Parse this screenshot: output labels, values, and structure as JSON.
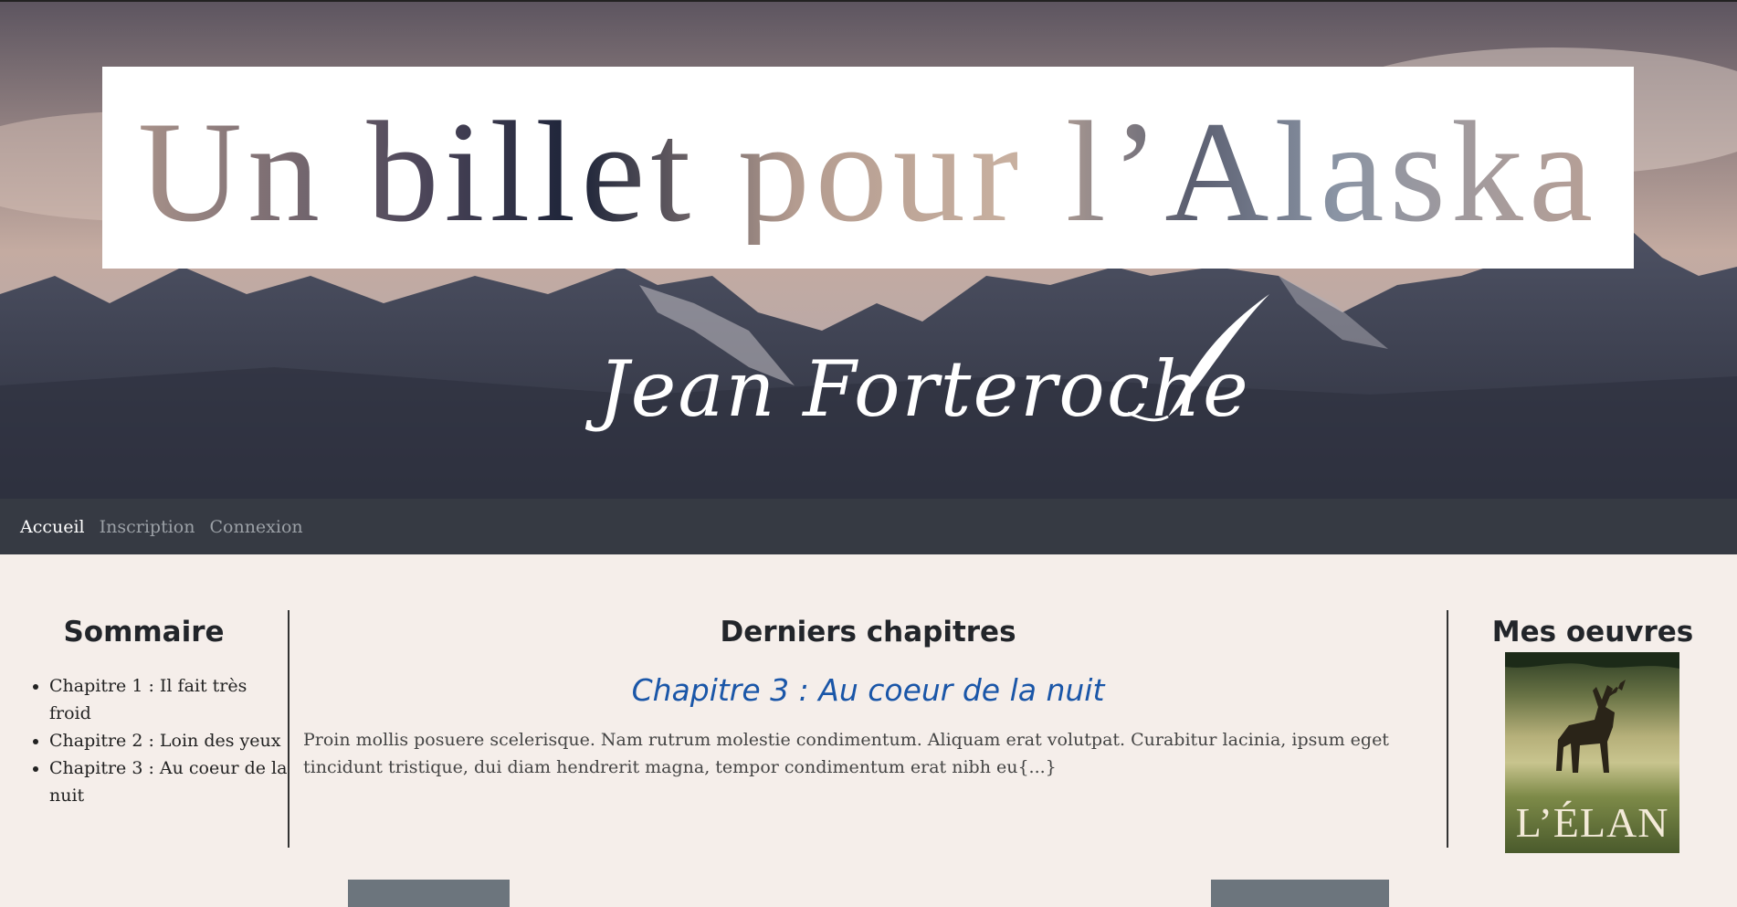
{
  "hero": {
    "title": "Un billet pour l’Alaska",
    "author": "Jean Forteroche"
  },
  "nav": {
    "items": [
      {
        "label": "Accueil",
        "active": true
      },
      {
        "label": "Inscription",
        "active": false
      },
      {
        "label": "Connexion",
        "active": false
      }
    ]
  },
  "sommaire": {
    "heading": "Sommaire",
    "chapters": [
      "Chapitre 1 : Il fait très froid",
      "Chapitre 2 : Loin des yeux",
      "Chapitre 3 : Au coeur de la nuit"
    ]
  },
  "latest": {
    "heading": "Derniers chapitres",
    "chapter_title": "Chapitre 3 : Au coeur de la nuit",
    "excerpt": "Proin mollis posuere scelerisque. Nam rutrum molestie condimentum. Aliquam erat volutpat. Curabitur lacinia, ipsum eget tincidunt tristique, dui diam hendrerit magna, tempor condimentum erat nibh eu{...}"
  },
  "oeuvres": {
    "heading": "Mes oeuvres",
    "book_title": "L’ÉLAN"
  },
  "colors": {
    "nav_bg": "#363a43",
    "page_bg": "#f5eeea",
    "link_blue": "#1a56a8",
    "button_gray": "#6c757d"
  }
}
